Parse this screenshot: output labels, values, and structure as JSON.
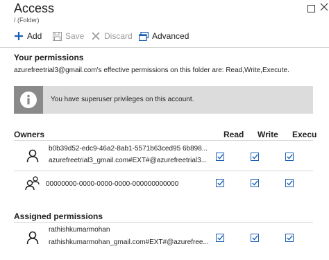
{
  "header": {
    "title": "Access",
    "subtitle": "/ (Folder)"
  },
  "toolbar": {
    "add": "Add",
    "save": "Save",
    "discard": "Discard",
    "advanced": "Advanced"
  },
  "your_permissions": {
    "heading": "Your permissions",
    "description": "azurefreetrial3@gmail.com's effective permissions on this folder are: Read,Write,Execute.",
    "banner": "You have superuser privileges on this account."
  },
  "columns": {
    "owners": "Owners",
    "read": "Read",
    "write": "Write",
    "execute": "Execu"
  },
  "owners": [
    {
      "line1": "b0b39d52-edc9-46a2-8ab1-5571b63ced95 6b898...",
      "line2": "azurefreetrial3_gmail.com#EXT#@azurefreetrial3...",
      "read": true,
      "write": true,
      "execute": true
    },
    {
      "line1": "00000000-0000-0000-0000-000000000000",
      "read": true,
      "write": true,
      "execute": true
    }
  ],
  "assigned": {
    "heading": "Assigned permissions",
    "rows": [
      {
        "line1": "rathishkumarmohan",
        "line2": "rathishkumarmohan_gmail.com#EXT#@azurefree...",
        "read": true,
        "write": true,
        "execute": true
      }
    ]
  }
}
